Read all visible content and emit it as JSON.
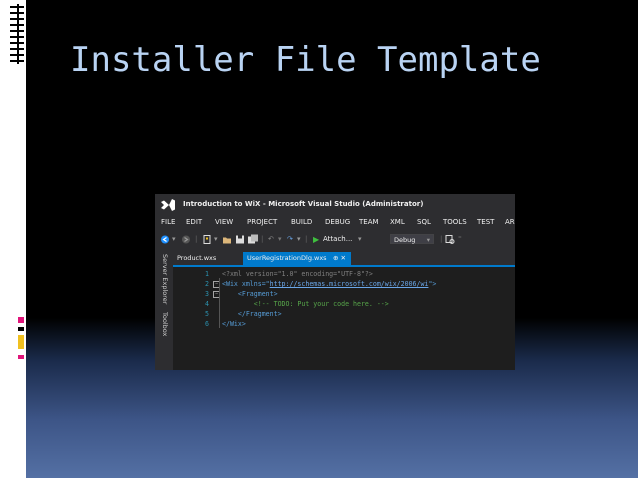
{
  "slide": {
    "title": "Installer File Template"
  },
  "window": {
    "title": "Introduction to WiX - Microsoft Visual Studio (Administrator)",
    "menu": [
      "FILE",
      "EDIT",
      "VIEW",
      "PROJECT",
      "BUILD",
      "DEBUG",
      "TEAM",
      "XML",
      "SQL",
      "TOOLS",
      "TEST",
      "AR"
    ],
    "toolbar": {
      "attach_label": "Attach...",
      "config_value": "Debug"
    },
    "side_tabs": [
      "Server Explorer",
      "Toolbox"
    ],
    "tabs": [
      {
        "label": "Product.wxs",
        "active": false
      },
      {
        "label": "UserRegistrationDlg.wxs",
        "active": true
      }
    ],
    "active_tab_icons": "⊕ ✕",
    "code_lines": [
      {
        "num": "1",
        "fold": "",
        "text_a": "<?xml version=\"1.0\" encoding=\"UTF-8\"?>"
      },
      {
        "num": "2",
        "fold": "−",
        "text_a": "<Wix xmlns=\"",
        "link": "http://schemas.microsoft.com/wix/2006/wi",
        "text_b": "\">"
      },
      {
        "num": "3",
        "fold": "−",
        "text_a": "    <Fragment>"
      },
      {
        "num": "4",
        "fold": "",
        "text_a": "        <!-- TODO: Put your code here. -->"
      },
      {
        "num": "5",
        "fold": "",
        "text_a": "    </Fragment>"
      },
      {
        "num": "6",
        "fold": "",
        "text_a": "</Wix>"
      }
    ]
  },
  "colors": {
    "title": "#b9d3f3",
    "accent": "#007acc",
    "deco_pink": "#e0157a",
    "deco_gold": "#f0c020"
  }
}
